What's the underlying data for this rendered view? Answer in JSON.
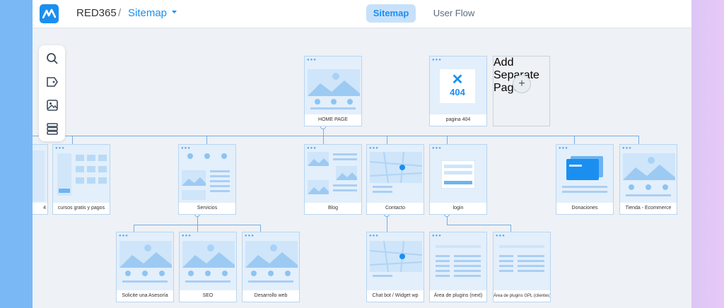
{
  "header": {
    "project": "RED365",
    "separator": "/",
    "section": "Sitemap",
    "tabs": [
      {
        "label": "Sitemap",
        "active": true
      },
      {
        "label": "User Flow",
        "active": false
      }
    ]
  },
  "toolbar": {
    "tools": [
      "search-icon",
      "tag-icon",
      "image-icon",
      "layers-icon"
    ]
  },
  "pages": {
    "home": "HOME PAGE",
    "p404": "pagina 404",
    "p404_code": "404",
    "add_page": "Add Separate Page",
    "left_cut": "4",
    "cursos": "cursos gratis y pagos",
    "servicios": "Servicios",
    "blog": "Blog",
    "contacto": "Contacto",
    "login": "login",
    "donaciones": "Donaciones",
    "tienda": "Tienda - Ecommerce",
    "asesoria": "Solicite una Asesoría",
    "seo": "SEO",
    "desarrollo": "Desarrollo web",
    "chatbot": "Chat bot / Widget wp",
    "plugins_next": "Área de plugins (next)",
    "plugins_gpl": "Área de plugins GPL (clientes)"
  },
  "colors": {
    "accent": "#1b8ff0",
    "connector": "#74aee8",
    "card": "#e3effb"
  }
}
